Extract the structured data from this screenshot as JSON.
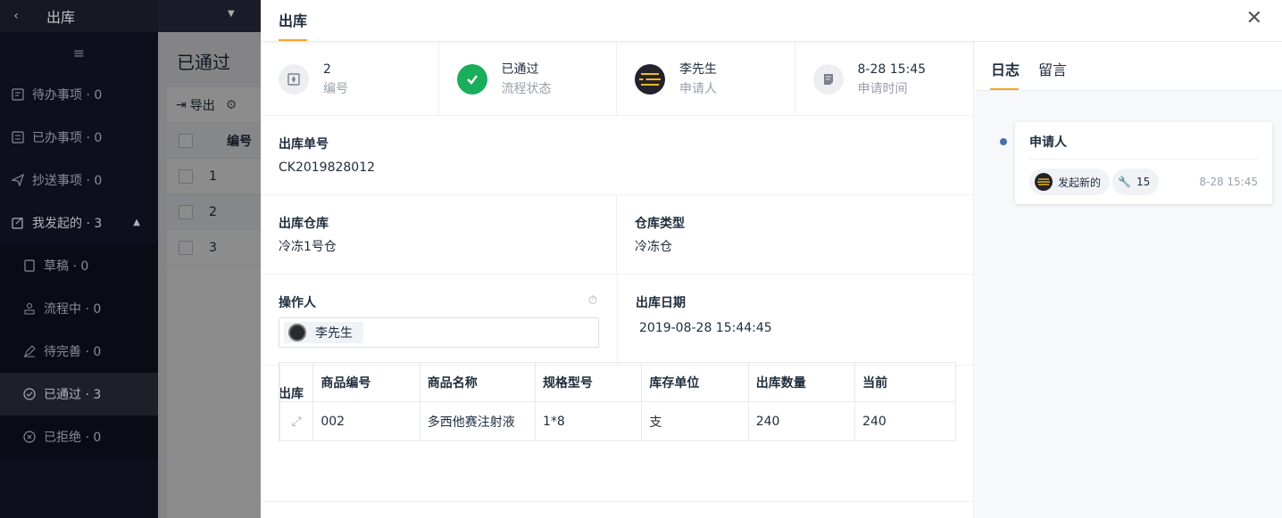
{
  "sidebar": {
    "title": "出库",
    "items": [
      {
        "label": "待办事项 · 0",
        "icon": "todo-icon"
      },
      {
        "label": "已办事项 · 0",
        "icon": "done-icon"
      },
      {
        "label": "抄送事项 · 0",
        "icon": "send-icon"
      },
      {
        "label": "我发起的 · 3",
        "icon": "initiated-icon"
      },
      {
        "label": "草稿 · 0",
        "icon": "draft-icon"
      },
      {
        "label": "流程中 · 0",
        "icon": "flow-icon"
      },
      {
        "label": "待完善 · 0",
        "icon": "edit-icon"
      },
      {
        "label": "已通过 · 3",
        "icon": "check-circle-icon"
      },
      {
        "label": "已拒绝 · 0",
        "icon": "close-circle-icon"
      }
    ]
  },
  "background_list": {
    "title": "已通过",
    "export_label": "导出",
    "header_col": "编号",
    "rows": [
      "1",
      "2",
      "3"
    ]
  },
  "drawer": {
    "title": "出库",
    "summary": [
      {
        "value": "2",
        "label": "编号"
      },
      {
        "value": "已通过",
        "label": "流程状态"
      },
      {
        "value": "李先生",
        "label": "申请人"
      },
      {
        "value": "8-28 15:45",
        "label": "申请时间"
      }
    ],
    "fields": {
      "order_no": {
        "label": "出库单号",
        "value": "CK2019828012"
      },
      "warehouse": {
        "label": "出库仓库",
        "value": "冷冻1号仓"
      },
      "warehouse_type": {
        "label": "仓库类型",
        "value": "冷冻仓"
      },
      "operator": {
        "label": "操作人",
        "value": "李先生"
      },
      "date": {
        "label": "出库日期",
        "value": "2019-08-28 15:44:45"
      }
    },
    "table": {
      "label": "出库",
      "columns": [
        "商品编号",
        "商品名称",
        "规格型号",
        "库存单位",
        "出库数量",
        "当前"
      ],
      "rows": [
        [
          "002",
          "多西他赛注射液",
          "1*8",
          "支",
          "240",
          "240"
        ]
      ]
    }
  },
  "side": {
    "tabs": [
      "日志",
      "留言"
    ],
    "log": {
      "title": "申请人",
      "tag1": "发起新的",
      "tag2": "15",
      "time": "8-28 15:45"
    }
  },
  "colors": {
    "accent": "#f5a623",
    "success": "#1aad5a",
    "dot": "#4a6ea8"
  }
}
